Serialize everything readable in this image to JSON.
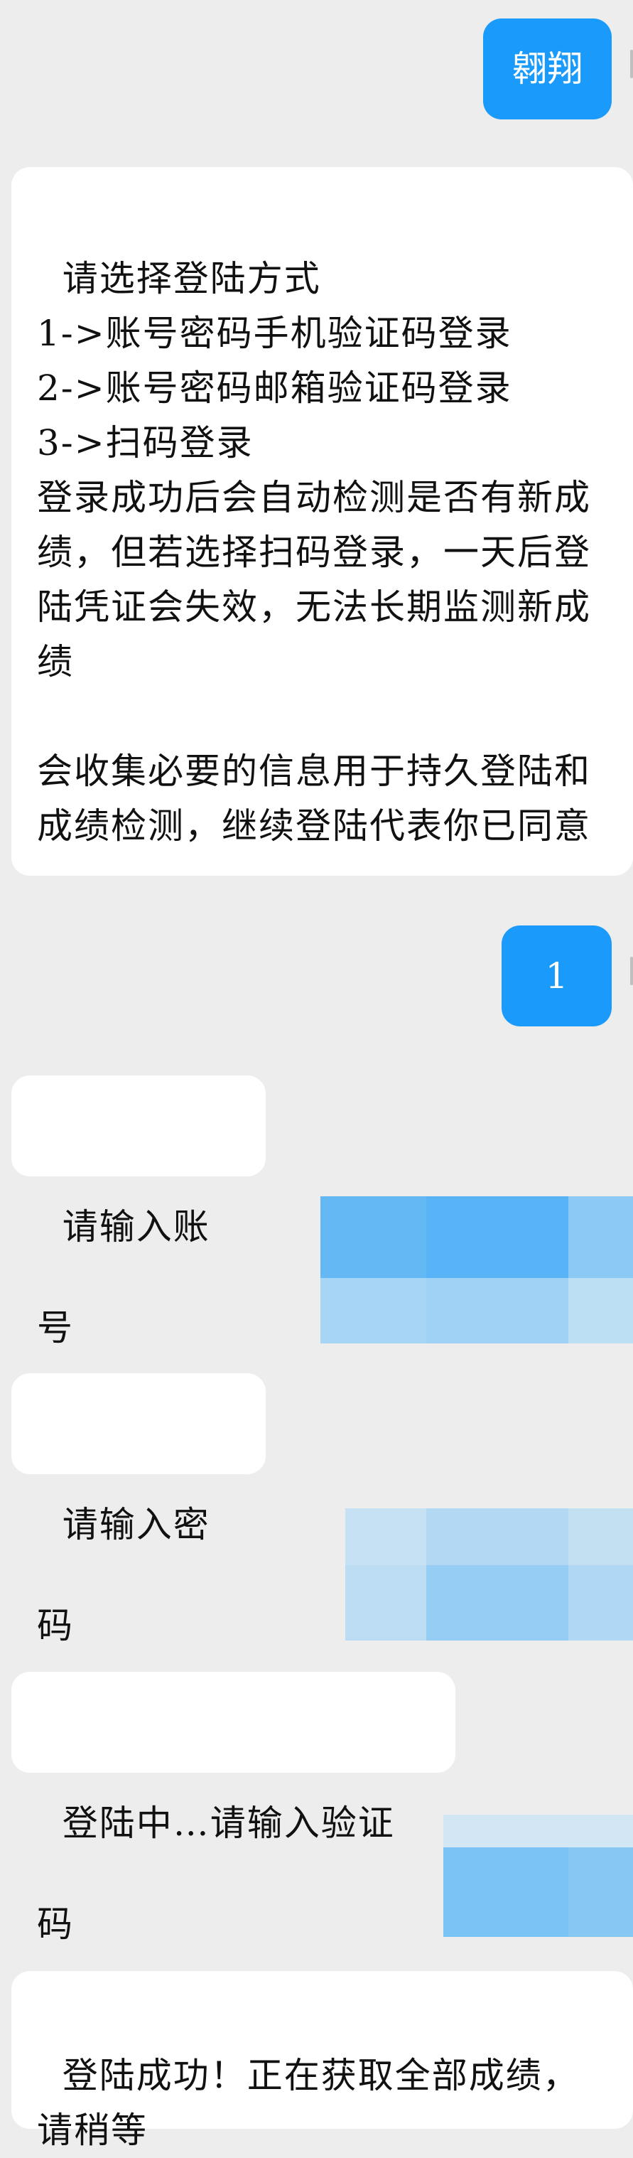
{
  "messages": [
    {
      "sender": "user",
      "text": "翱翔"
    },
    {
      "sender": "bot",
      "text": "请选择登陆方式\n1->账号密码手机验证码登录\n2->账号密码邮箱验证码登录\n3->扫码登录\n登录成功后会自动检测是否有新成绩，但若选择扫码登录，一天后登陆凭证会失效，无法长期监测新成绩\n\n会收集必要的信息用于持久登陆和成绩检测，继续登陆代表你已同意"
    },
    {
      "sender": "user",
      "text": "1"
    },
    {
      "sender": "bot",
      "text": "请输入账号"
    },
    {
      "sender": "user",
      "pixelated": true
    },
    {
      "sender": "bot",
      "text": "请输入密码"
    },
    {
      "sender": "user",
      "pixelated": true
    },
    {
      "sender": "bot",
      "text": "登陆中…请输入验证码"
    },
    {
      "sender": "user",
      "pixelated": true
    },
    {
      "sender": "bot",
      "text": "登陆成功！正在获取全部成绩，请稍等"
    }
  ],
  "colors": {
    "background": "#ededed",
    "bot_bubble": "#ffffff",
    "user_bubble": "#1a9bfc",
    "text": "#111111"
  }
}
